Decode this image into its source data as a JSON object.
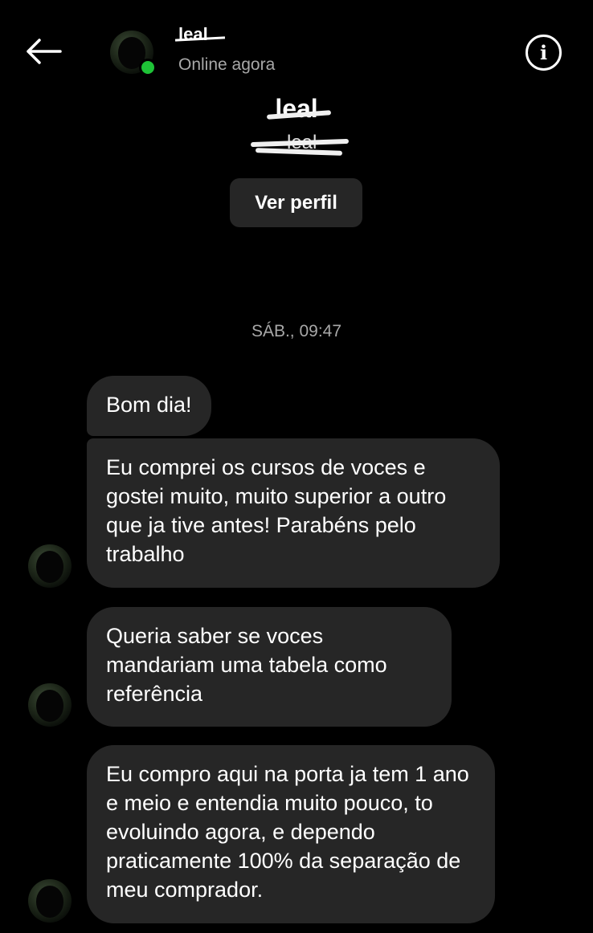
{
  "header": {
    "name": "leal",
    "status": "Online agora",
    "icons": {
      "back": "arrow-left-icon",
      "info": "info-icon"
    }
  },
  "profile": {
    "name": "leal",
    "handle": "_leal",
    "view_profile_label": "Ver perfil"
  },
  "conversation": {
    "timestamp": "SÁB., 09:47",
    "messages": [
      {
        "text": "Bom dia!"
      },
      {
        "text": "Eu comprei os cursos de voces e gostei muito, muito superior a outro que ja tive antes! Parabéns pelo trabalho"
      },
      {
        "text": "Queria saber se voces mandariam uma tabela como referência"
      },
      {
        "text": "Eu compro aqui na porta ja tem 1 ano e meio e entendia muito pouco, to evoluindo agora, e dependo praticamente 100% da separação de meu comprador."
      }
    ]
  },
  "colors": {
    "background": "#000000",
    "bubble": "#262626",
    "secondary_text": "#a8a8a8",
    "online": "#1ec337"
  }
}
